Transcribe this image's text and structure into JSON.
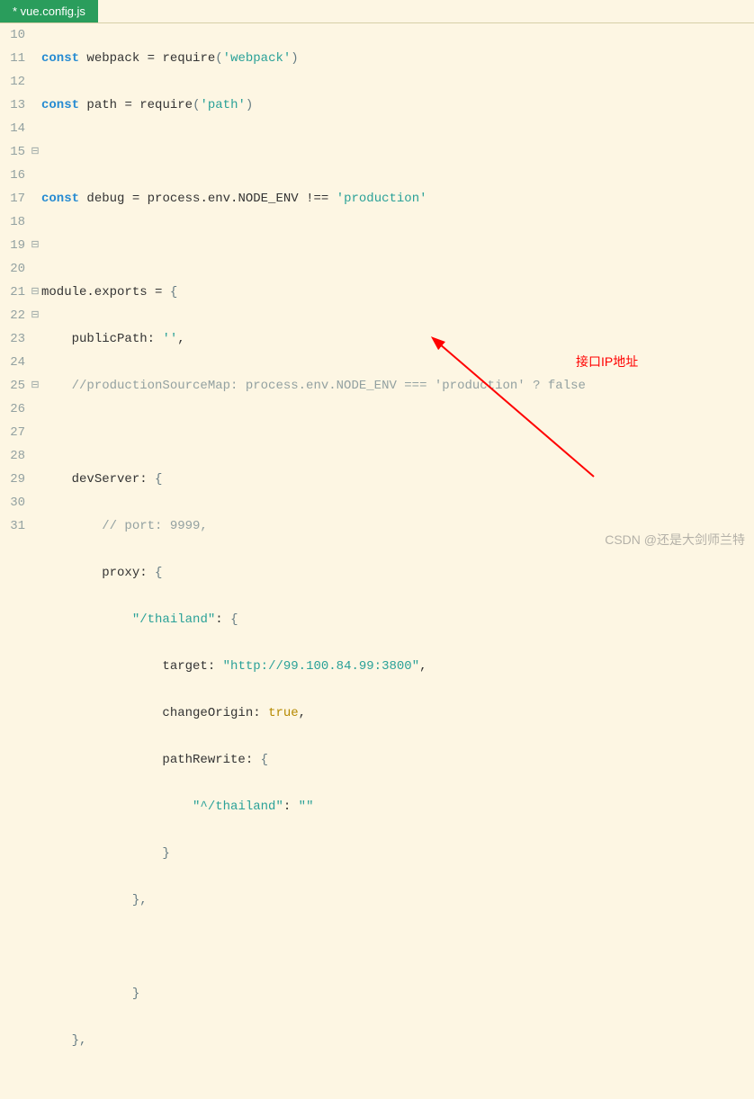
{
  "tab": {
    "title": "* vue.config.js"
  },
  "lines": {
    "start": 10,
    "end": 31
  },
  "code": {
    "l10": {
      "kw": "const",
      "name": " webpack ",
      "op": "=",
      "fn": " require",
      "paren_o": "(",
      "str": "'webpack'",
      "paren_c": ")"
    },
    "l11": {
      "kw": "const",
      "name": " path ",
      "op": "=",
      "fn": " require",
      "paren_o": "(",
      "str": "'path'",
      "paren_c": ")"
    },
    "l13": {
      "kw": "const",
      "name": " debug ",
      "op": "=",
      "expr": " process.env.NODE_ENV ",
      "neq": "!==",
      "str": " 'production'"
    },
    "l15": {
      "text1": "module.exports ",
      "op": "=",
      "brace": " {"
    },
    "l16": {
      "indent": "    ",
      "prop": "publicPath",
      "colon": ": ",
      "str": "''",
      "comma": ","
    },
    "l17": {
      "indent": "    ",
      "comment": "//productionSourceMap: process.env.NODE_ENV === 'production' ? false"
    },
    "l19": {
      "indent": "    ",
      "prop": "devServer",
      "colon": ": ",
      "brace": "{"
    },
    "l20": {
      "indent": "        ",
      "comment": "// port: 9999,"
    },
    "l21": {
      "indent": "        ",
      "prop": "proxy",
      "colon": ": ",
      "brace": "{"
    },
    "l22": {
      "indent": "            ",
      "str": "\"/thailand\"",
      "colon": ": ",
      "brace": "{"
    },
    "l23": {
      "indent": "                ",
      "prop": "target",
      "colon": ": ",
      "str": "\"http://99.100.84.99:3800\"",
      "comma": ","
    },
    "l24": {
      "indent": "                ",
      "prop": "changeOrigin",
      "colon": ": ",
      "bool": "true",
      "comma": ","
    },
    "l25": {
      "indent": "                ",
      "prop": "pathRewrite",
      "colon": ": ",
      "brace": "{"
    },
    "l26": {
      "indent": "                    ",
      "str1": "\"^/thailand\"",
      "colon": ": ",
      "str2": "\"\""
    },
    "l27": {
      "indent": "                ",
      "brace": "}"
    },
    "l28": {
      "indent": "            ",
      "brace": "},"
    },
    "l30": {
      "indent": "            ",
      "brace": "}"
    },
    "l31": {
      "indent": "    ",
      "brace": "},"
    }
  },
  "fold": {
    "l15": "⊟",
    "l19": "⊟",
    "l21": "⊟",
    "l22": "⊟",
    "l25": "⊟"
  },
  "annotation": {
    "label": "接口IP地址"
  },
  "watermark": {
    "text": "CSDN @还是大剑师兰特"
  }
}
